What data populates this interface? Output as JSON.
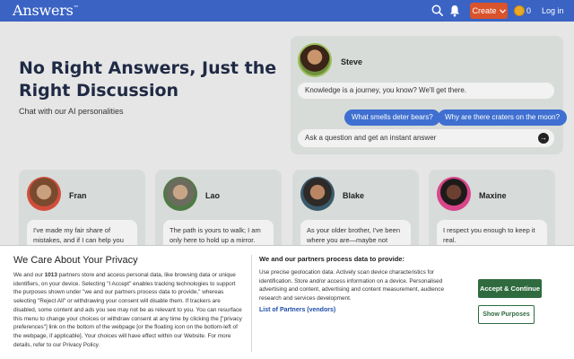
{
  "header": {
    "logo": "Answers",
    "logo_mark": "™",
    "create_label": "Create",
    "coin_count": "0",
    "login_label": "Log in"
  },
  "hero": {
    "title": "No Right Answers, Just the Right Discussion",
    "subtitle": "Chat with our AI personalities"
  },
  "chat": {
    "name": "Steve",
    "message": "Knowledge is a journey, you know? We'll get there.",
    "suggestions": [
      "What smells deter bears?",
      "Why are there craters on the moon?"
    ],
    "input_placeholder": "Ask a question and get an instant answer"
  },
  "personas": [
    {
      "name": "Fran",
      "quote": "I've made my fair share of mistakes, and if I can help you"
    },
    {
      "name": "Lao",
      "quote": "The path is yours to walk; I am only here to hold up a mirror."
    },
    {
      "name": "Blake",
      "quote": "As your older brother, I've been where you are—maybe not"
    },
    {
      "name": "Maxine",
      "quote": "I respect you enough to keep it real."
    }
  ],
  "consent": {
    "title": "We Care About Your Privacy",
    "text_before": "We and our ",
    "partner_count": "1013",
    "text_after": " partners store and access personal data, like browsing data or unique identifiers, on your device. Selecting \"I Accept\" enables tracking technologies to support the purposes shown under \"we and our partners process data to provide,\" whereas selecting \"Reject All\" or withdrawing your consent will disable them. If trackers are disabled, some content and ads you see may not be as relevant to you. You can resurface this menu to change your choices or withdraw consent at any time by clicking the [\"privacy preferences\"] link on the bottom of the webpage [or the floating icon on the bottom-left of the webpage, if applicable]. Your choices will have effect within our Website. For more details, refer to our Privacy Policy.",
    "purposes_title": "We and our partners process data to provide:",
    "purposes_text": "Use precise geolocation data. Actively scan device characteristics for identification. Store and/or access information on a device. Personalised advertising and content, advertising and content measurement, audience research and services development.",
    "partners_link": "List of Partners (vendors)",
    "accept_label": "Accept & Continue",
    "show_purposes_label": "Show Purposes"
  }
}
